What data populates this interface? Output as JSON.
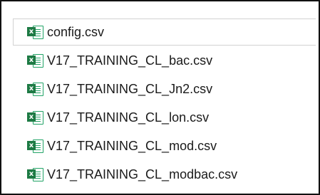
{
  "colors": {
    "excel_green": "#1d7a44",
    "excel_green_light": "#21a366",
    "border": "#d2d2d2",
    "text": "#1a1a1a"
  },
  "files": [
    {
      "name": "config.csv",
      "icon": "excel-csv-icon",
      "selected": true
    },
    {
      "name": "V17_TRAINING_CL_bac.csv",
      "icon": "excel-csv-icon",
      "selected": false
    },
    {
      "name": "V17_TRAINING_CL_Jn2.csv",
      "icon": "excel-csv-icon",
      "selected": false
    },
    {
      "name": "V17_TRAINING_CL_lon.csv",
      "icon": "excel-csv-icon",
      "selected": false
    },
    {
      "name": "V17_TRAINING_CL_mod.csv",
      "icon": "excel-csv-icon",
      "selected": false
    },
    {
      "name": "V17_TRAINING_CL_modbac.csv",
      "icon": "excel-csv-icon",
      "selected": false
    }
  ]
}
